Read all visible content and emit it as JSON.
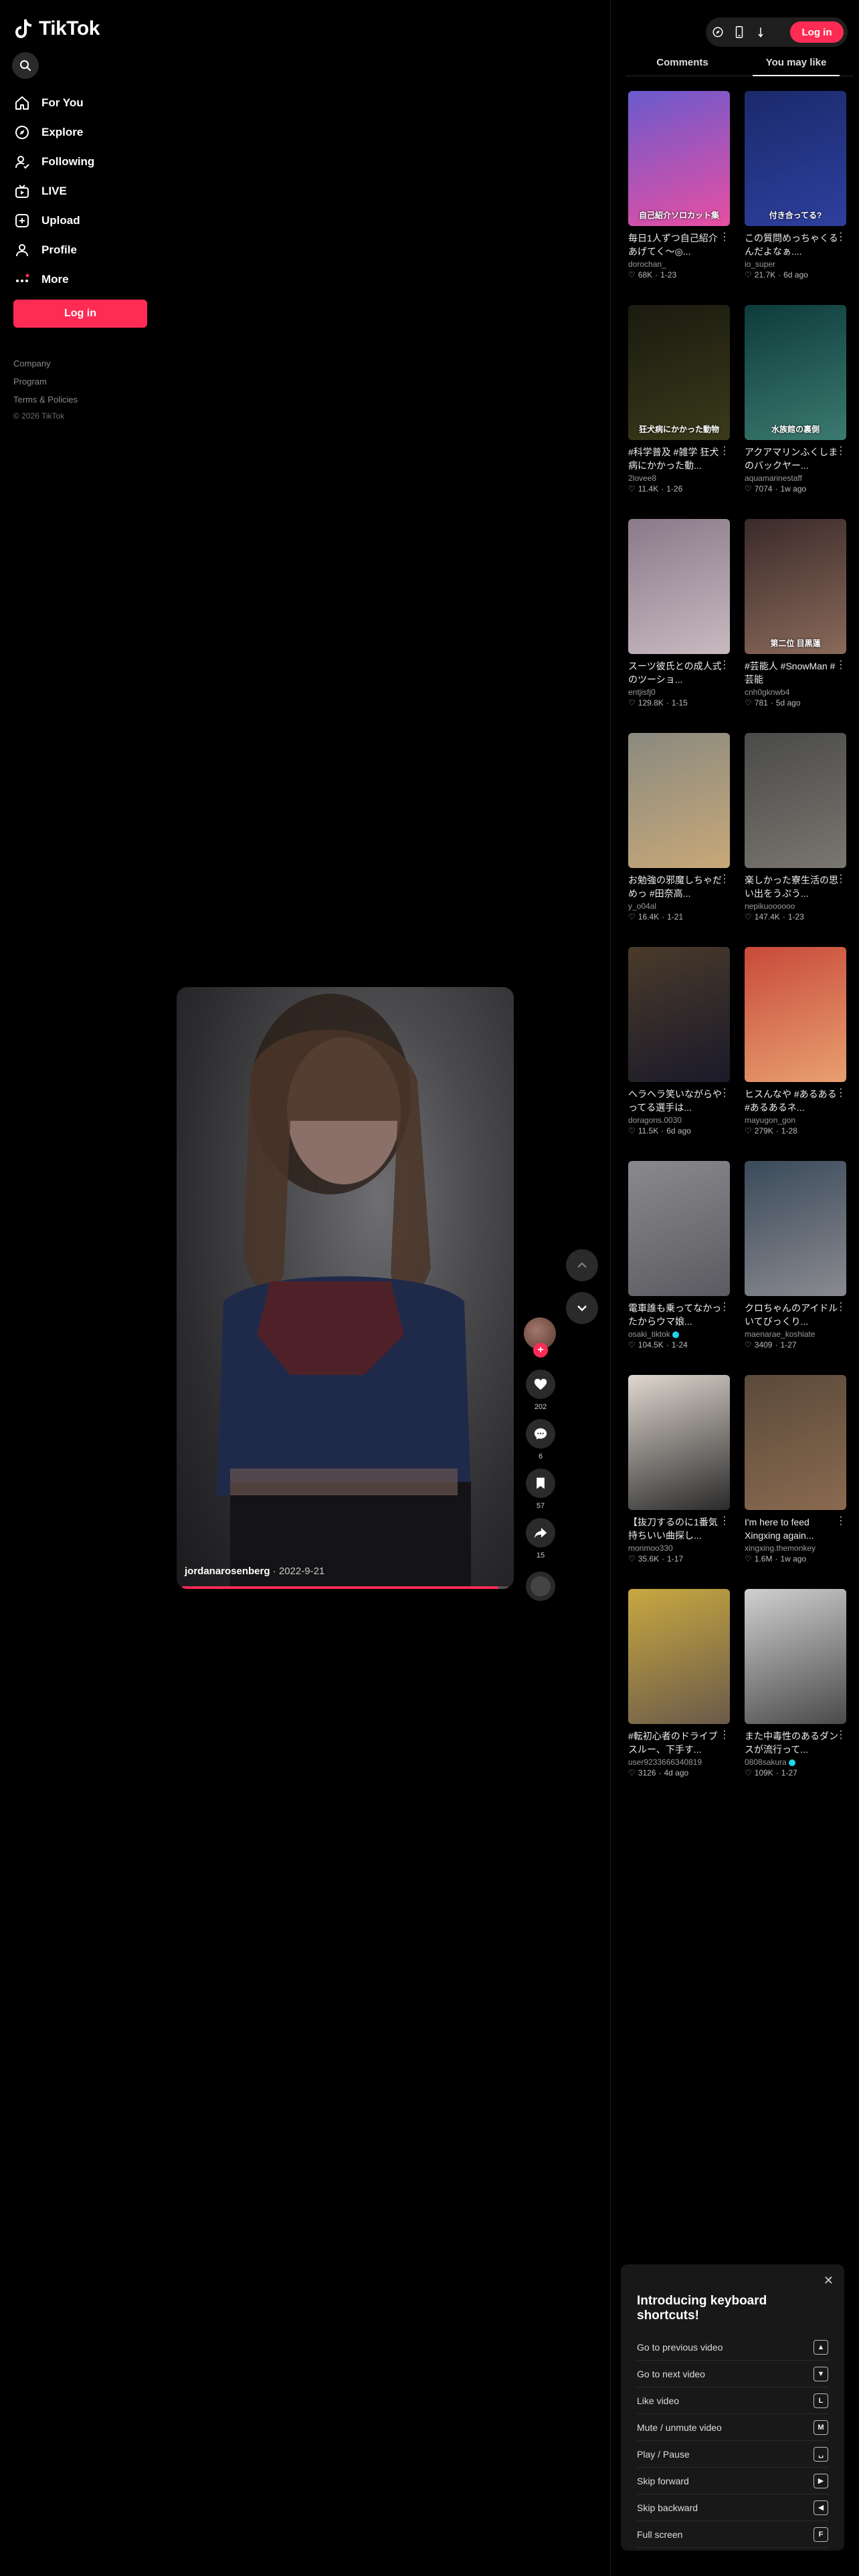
{
  "brand": {
    "name": "TikTok",
    "accent": "#fe2c55"
  },
  "sidebar": {
    "items": [
      {
        "label": "For You",
        "icon": "home-icon"
      },
      {
        "label": "Explore",
        "icon": "compass-icon"
      },
      {
        "label": "Following",
        "icon": "user-follow-icon"
      },
      {
        "label": "LIVE",
        "icon": "live-tv-icon"
      },
      {
        "label": "Upload",
        "icon": "plus-square-icon"
      },
      {
        "label": "Profile",
        "icon": "person-icon"
      },
      {
        "label": "More",
        "icon": "dots-icon"
      }
    ],
    "login_label": "Log in",
    "footer": {
      "company": "Company",
      "program": "Program",
      "terms": "Terms & Policies",
      "copyright": "© 2026 TikTok"
    }
  },
  "video": {
    "username": "jordanarosenberg",
    "separator": " · ",
    "date": "2022-9-21",
    "progress": 0.97,
    "likes": "202",
    "comments": "6",
    "bookmarks": "57",
    "shares": "15"
  },
  "topbar": {
    "login_label": "Log in"
  },
  "tabs": {
    "comments": "Comments",
    "you_may_like": "You may like"
  },
  "recommendations": [
    {
      "title": "毎日1人ずつ自己紹介あげてく〜◎...",
      "user": "dorochan_",
      "likes": "68K",
      "age": "1-23",
      "overlay": "自己紹介ソロカット集",
      "colors": [
        "#6a5acd",
        "#e84fa2"
      ],
      "verified": false
    },
    {
      "title": "この質問めっちゃくるんだよなぁ....",
      "user": "io_super",
      "likes": "21.7K",
      "age": "6d ago",
      "overlay": "付き合ってる?",
      "colors": [
        "#1b2a6b",
        "#2e3f9e"
      ],
      "verified": false
    },
    {
      "title": "#科学普及 #雑学 狂犬病にかかった動...",
      "user": "2lovee8",
      "likes": "11.4K",
      "age": "1-26",
      "overlay": "狂犬病にかかった動物",
      "colors": [
        "#1a1a10",
        "#3a3a1a"
      ],
      "verified": false
    },
    {
      "title": "アクアマリンふくしまのバックヤー...",
      "user": "aquamarinestaff",
      "likes": "7074",
      "age": "1w ago",
      "overlay": "水族館の裏側",
      "colors": [
        "#0d3b3b",
        "#3b7a70"
      ],
      "verified": false
    },
    {
      "title": "スーツ彼氏との成人式のツーショ...",
      "user": "entjisfj0",
      "likes": "129.8K",
      "age": "1-15",
      "overlay": "",
      "colors": [
        "#8a7a8a",
        "#c9b9c0"
      ],
      "verified": false
    },
    {
      "title": "#芸能人 #SnowMan #芸能",
      "user": "cnh0gknwb4",
      "likes": "781",
      "age": "5d ago",
      "overlay": "第二位 目黒蓮",
      "colors": [
        "#3a2a2a",
        "#8a6a5a"
      ],
      "verified": false
    },
    {
      "title": "お勉強の邪魔しちゃだめっ #田奈高...",
      "user": "y_o04al",
      "likes": "16.4K",
      "age": "1-21",
      "overlay": "",
      "colors": [
        "#8a8a80",
        "#c8a878"
      ],
      "verified": false
    },
    {
      "title": "楽しかった寮生活の思い出をうぷう...",
      "user": "nepikuoooooo",
      "likes": "147.4K",
      "age": "1-23",
      "overlay": "",
      "colors": [
        "#4a4a48",
        "#7a7670"
      ],
      "verified": false
    },
    {
      "title": "ヘラヘラ笑いながらやってる選手は...",
      "user": "doragons.0030",
      "likes": "11.5K",
      "age": "6d ago",
      "overlay": "",
      "colors": [
        "#4a3a2a",
        "#1a1a2a"
      ],
      "verified": false
    },
    {
      "title": "ヒスんなや #あるある #あるあるネ...",
      "user": "mayugon_gon",
      "likes": "279K",
      "age": "1-28",
      "overlay": "",
      "colors": [
        "#c84a3a",
        "#e8a070"
      ],
      "verified": false
    },
    {
      "title": "電車誰も乗ってなかったからウマ娘...",
      "user": "osaki_tiktok",
      "likes": "104.5K",
      "age": "1-24",
      "overlay": "",
      "colors": [
        "#8a8a8e",
        "#5a5a60"
      ],
      "verified": true
    },
    {
      "title": "クロちゃんのアイドルいてびっくり...",
      "user": "maenarae_koshiate",
      "likes": "3409",
      "age": "1-27",
      "overlay": "",
      "colors": [
        "#3a4a5a",
        "#8a8a90"
      ],
      "verified": false
    },
    {
      "title": "【抜刀するのに1番気持ちいい曲探し...",
      "user": "morimoo330",
      "likes": "35.6K",
      "age": "1-17",
      "overlay": "",
      "colors": [
        "#e0d8d0",
        "#2a2a2a"
      ],
      "verified": false
    },
    {
      "title": "I'm here to feed Xingxing again...",
      "user": "xingxing.themonkey",
      "likes": "1.6M",
      "age": "1w ago",
      "overlay": "",
      "colors": [
        "#5a4a3a",
        "#8a6a50"
      ],
      "verified": false
    },
    {
      "title": "#転初心者のドライブスルー、下手す...",
      "user": "user9233666340819",
      "likes": "3126",
      "age": "4d ago",
      "overlay": "",
      "colors": [
        "#c8a840",
        "#6a5a4a"
      ],
      "verified": false
    },
    {
      "title": "また中毒性のあるダンスが流行って...",
      "user": "0808sakura",
      "likes": "109K",
      "age": "1-27",
      "overlay": "",
      "colors": [
        "#d0d0d0",
        "#4a4a4a"
      ],
      "verified": true
    }
  ],
  "shortcuts": {
    "title": "Introducing keyboard shortcuts!",
    "items": [
      {
        "label": "Go to previous video",
        "key": "▲"
      },
      {
        "label": "Go to next video",
        "key": "▼"
      },
      {
        "label": "Like video",
        "key": "L"
      },
      {
        "label": "Mute / unmute video",
        "key": "M"
      },
      {
        "label": "Play / Pause",
        "key": "␣"
      },
      {
        "label": "Skip forward",
        "key": "▶"
      },
      {
        "label": "Skip backward",
        "key": "◀"
      },
      {
        "label": "Full screen",
        "key": "F"
      }
    ]
  }
}
